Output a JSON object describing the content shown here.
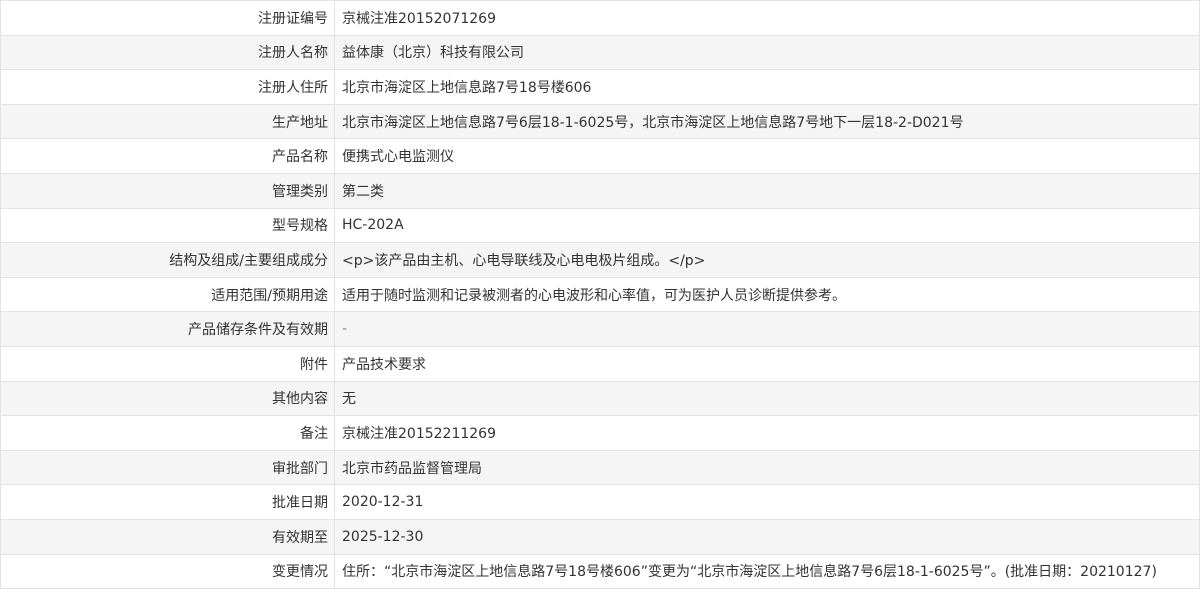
{
  "rows": [
    {
      "label": "注册证编号",
      "value": "京械注准20152071269"
    },
    {
      "label": "注册人名称",
      "value": "益体康（北京）科技有限公司"
    },
    {
      "label": "注册人住所",
      "value": "北京市海淀区上地信息路7号18号楼606"
    },
    {
      "label": "生产地址",
      "value": "北京市海淀区上地信息路7号6层18-1-6025号，北京市海淀区上地信息路7号地下一层18-2-D021号"
    },
    {
      "label": "产品名称",
      "value": "便携式心电监测仪"
    },
    {
      "label": "管理类别",
      "value": "第二类"
    },
    {
      "label": "型号规格",
      "value": "HC-202A"
    },
    {
      "label": "结构及组成/主要组成成分",
      "value": "<p>该产品由主机、心电导联线及心电电极片组成。</p>"
    },
    {
      "label": "适用范围/预期用途",
      "value": "适用于随时监测和记录被测者的心电波形和心率值，可为医护人员诊断提供参考。"
    },
    {
      "label": "产品储存条件及有效期",
      "value": "-"
    },
    {
      "label": "附件",
      "value": "产品技术要求"
    },
    {
      "label": "其他内容",
      "value": "无"
    },
    {
      "label": "备注",
      "value": "京械注准20152211269"
    },
    {
      "label": "审批部门",
      "value": "北京市药品监督管理局"
    },
    {
      "label": "批准日期",
      "value": "2020-12-31"
    },
    {
      "label": "有效期至",
      "value": "2025-12-30"
    },
    {
      "label": "变更情况",
      "value": "住所：“北京市海淀区上地信息路7号18号楼606”变更为“北京市海淀区上地信息路7号6层18-1-6025号”。(批准日期：20210127)"
    }
  ]
}
